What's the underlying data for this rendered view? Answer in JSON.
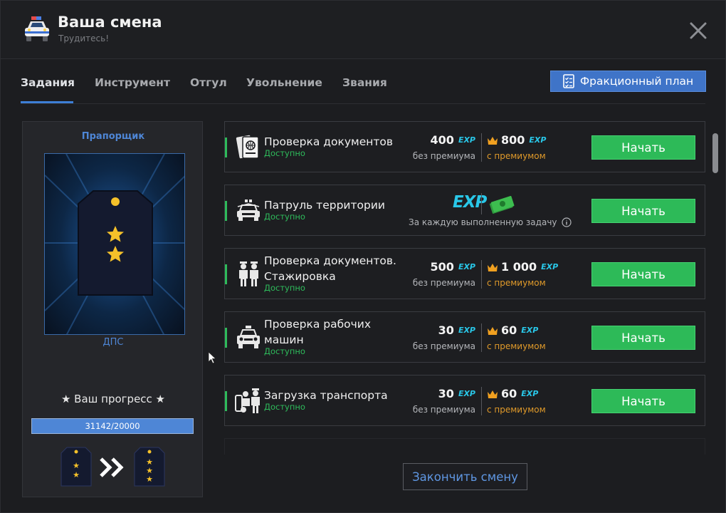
{
  "header": {
    "title": "Ваша смена",
    "subtitle": "Трудитесь!"
  },
  "tabs": [
    {
      "label": "Задания",
      "active": true
    },
    {
      "label": "Инструмент",
      "active": false
    },
    {
      "label": "Отгул",
      "active": false
    },
    {
      "label": "Увольнение",
      "active": false
    },
    {
      "label": "Звания",
      "active": false
    }
  ],
  "plan_button": {
    "label": "Фракционный план"
  },
  "rank": {
    "name": "Прапорщик",
    "unit": "ДПС",
    "progress_label": "★ Ваш прогресс ★",
    "progress_text": "31142/20000",
    "progress_fraction": 1.0
  },
  "tasks": [
    {
      "name": "Проверка документов",
      "status": "Доступно",
      "icon": "passport-icon",
      "base_value": "400",
      "premium_value": "800",
      "exp": "EXP",
      "base_label": "без премиума",
      "premium_label": "с премиумом",
      "button": "Начать"
    },
    {
      "name": "Патруль территории",
      "status": "Доступно",
      "icon": "police-car-icon",
      "exp": "EXP",
      "note": "За каждую выполненную задачу",
      "button": "Начать"
    },
    {
      "name": "Проверка документов.",
      "name2": "Стажировка",
      "status": "Доступно",
      "icon": "officers-icon",
      "base_value": "500",
      "premium_value": "1 000",
      "exp": "EXP",
      "base_label": "без премиума",
      "premium_label": "с премиумом",
      "button": "Начать"
    },
    {
      "name": "Проверка рабочих",
      "name2": "машин",
      "status": "Доступно",
      "icon": "police-car-front-icon",
      "base_value": "30",
      "premium_value": "60",
      "exp": "EXP",
      "base_label": "без премиума",
      "premium_label": "с премиумом",
      "button": "Начать"
    },
    {
      "name": "Загрузка транспорта",
      "status": "Доступно",
      "icon": "officers-cargo-icon",
      "base_value": "30",
      "premium_value": "60",
      "exp": "EXP",
      "base_label": "без премиума",
      "premium_label": "с премиумом",
      "button": "Начать"
    }
  ],
  "end_shift": {
    "label": "Закончить смену"
  },
  "colors": {
    "accent_blue": "#3d7fd6",
    "green": "#2dba58",
    "exp_cyan": "#29c7e8",
    "premium_orange": "#e09a2a"
  }
}
